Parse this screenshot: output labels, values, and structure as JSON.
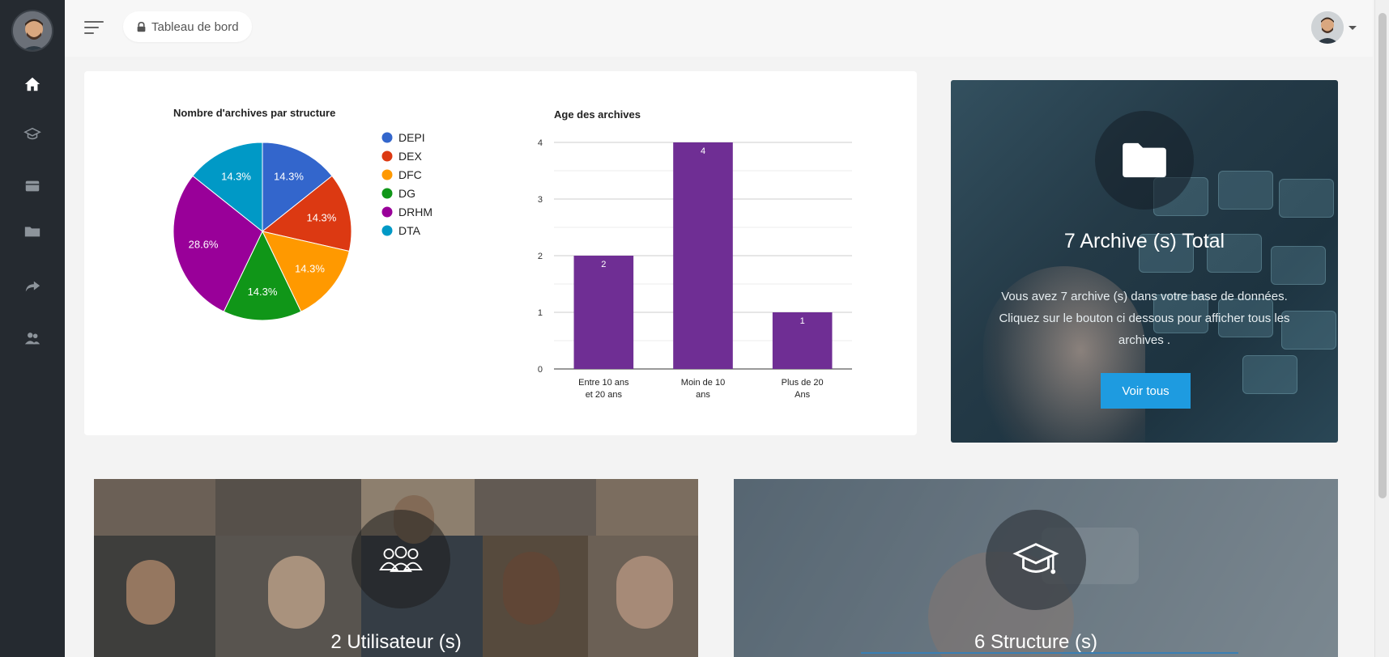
{
  "breadcrumb": {
    "label": "Tableau de bord",
    "icon": "lock-icon"
  },
  "sidebar": {
    "items": [
      {
        "name": "home",
        "icon": "home-icon",
        "active": true
      },
      {
        "name": "structures",
        "icon": "graduation-cap-icon"
      },
      {
        "name": "archive-box",
        "icon": "archive-icon"
      },
      {
        "name": "folders",
        "icon": "folder-icon"
      },
      {
        "name": "share",
        "icon": "share-arrow-icon"
      },
      {
        "name": "users",
        "icon": "users-icon"
      }
    ]
  },
  "charts": [
    {
      "type": "pie",
      "title": "Nombre d'archives par structure",
      "slices": [
        {
          "label": "DEPI",
          "value": 14.3,
          "text": "14.3%",
          "color": "#3366cc"
        },
        {
          "label": "DEX",
          "value": 14.3,
          "text": "14.3%",
          "color": "#dc3912"
        },
        {
          "label": "DFC",
          "value": 14.3,
          "text": "14.3%",
          "color": "#ff9900"
        },
        {
          "label": "DG",
          "value": 14.3,
          "text": "14.3%",
          "color": "#109618"
        },
        {
          "label": "DRHM",
          "value": 28.6,
          "text": "28.6%",
          "color": "#990099"
        },
        {
          "label": "DTA",
          "value": 14.3,
          "text": "14.3%",
          "color": "#0099c6"
        }
      ]
    },
    {
      "type": "bar",
      "title": "Age des archives",
      "categories": [
        [
          "Entre 10 ans",
          "et 20 ans"
        ],
        [
          "Moin de 10",
          "ans"
        ],
        [
          "Plus de 20",
          "Ans"
        ]
      ],
      "values": [
        2,
        4,
        1
      ],
      "ylim": [
        0,
        4
      ],
      "yticks": [
        "0",
        "1",
        "2",
        "3",
        "4"
      ],
      "color": "#6f2e94"
    }
  ],
  "archive_card": {
    "title": "7 Archive (s) Total",
    "description": "Vous avez 7 archive (s) dans votre base de données. Cliquez sur le bouton ci dessous pour afficher tous les archives .",
    "button": "Voir tous",
    "icon": "folder-icon"
  },
  "users_card": {
    "title": "2 Utilisateur (s)",
    "icon": "users-group-icon"
  },
  "structure_card": {
    "title": "6 Structure (s)",
    "icon": "graduation-cap-icon"
  }
}
